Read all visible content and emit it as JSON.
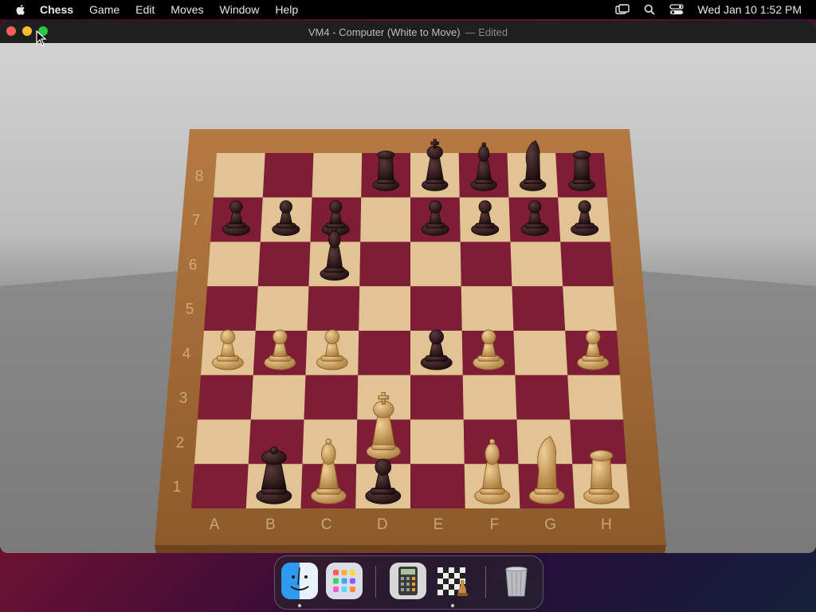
{
  "menubar": {
    "app_name": "Chess",
    "items": [
      "Game",
      "Edit",
      "Moves",
      "Window",
      "Help"
    ],
    "datetime": "Wed Jan 10  1:52 PM"
  },
  "window": {
    "title": "VM4 - Computer   (White to Move)",
    "edited": "— Edited"
  },
  "board": {
    "files": [
      "A",
      "B",
      "C",
      "D",
      "E",
      "F",
      "G",
      "H"
    ],
    "ranks": [
      "1",
      "2",
      "3",
      "4",
      "5",
      "6",
      "7",
      "8"
    ],
    "pieces": [
      {
        "sq": "d8",
        "color": "black",
        "type": "rook"
      },
      {
        "sq": "e8",
        "color": "black",
        "type": "king"
      },
      {
        "sq": "f8",
        "color": "black",
        "type": "bishop"
      },
      {
        "sq": "g8",
        "color": "black",
        "type": "knight"
      },
      {
        "sq": "h8",
        "color": "black",
        "type": "rook"
      },
      {
        "sq": "a7",
        "color": "black",
        "type": "pawn"
      },
      {
        "sq": "b7",
        "color": "black",
        "type": "pawn"
      },
      {
        "sq": "c7",
        "color": "black",
        "type": "pawn"
      },
      {
        "sq": "e7",
        "color": "black",
        "type": "pawn"
      },
      {
        "sq": "f7",
        "color": "black",
        "type": "pawn"
      },
      {
        "sq": "g7",
        "color": "black",
        "type": "pawn"
      },
      {
        "sq": "h7",
        "color": "black",
        "type": "pawn"
      },
      {
        "sq": "c6",
        "color": "black",
        "type": "bishop"
      },
      {
        "sq": "e4",
        "color": "black",
        "type": "pawn"
      },
      {
        "sq": "b1",
        "color": "black",
        "type": "queen"
      },
      {
        "sq": "d1",
        "color": "black",
        "type": "pawn"
      },
      {
        "sq": "a4",
        "color": "white",
        "type": "pawn"
      },
      {
        "sq": "b4",
        "color": "white",
        "type": "pawn"
      },
      {
        "sq": "c4",
        "color": "white",
        "type": "pawn"
      },
      {
        "sq": "f4",
        "color": "white",
        "type": "pawn"
      },
      {
        "sq": "h4",
        "color": "white",
        "type": "pawn"
      },
      {
        "sq": "d2",
        "color": "white",
        "type": "king"
      },
      {
        "sq": "c1",
        "color": "white",
        "type": "bishop"
      },
      {
        "sq": "f1",
        "color": "white",
        "type": "bishop"
      },
      {
        "sq": "g1",
        "color": "white",
        "type": "knight"
      },
      {
        "sq": "h1",
        "color": "white",
        "type": "rook"
      }
    ]
  },
  "colors": {
    "light_square": "#e2c394",
    "dark_square": "#7e1d36",
    "frame": "#a36b38",
    "black_piece": "#2a1416",
    "white_piece": "#d7a863"
  },
  "dock": {
    "apps": [
      "finder-icon",
      "launchpad-icon",
      "calculator-icon",
      "chess-icon",
      "trash-icon"
    ]
  }
}
